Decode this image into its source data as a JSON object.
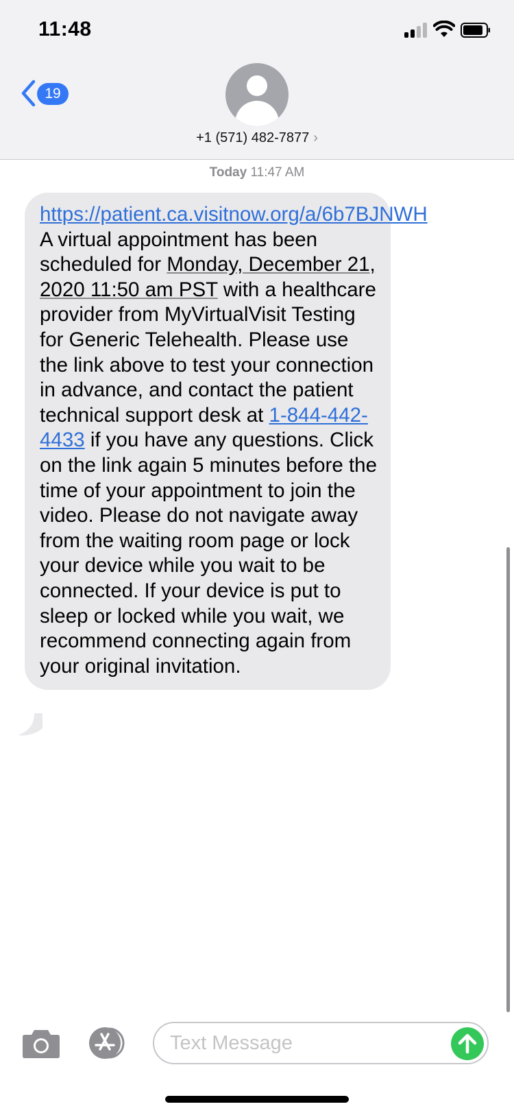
{
  "status_bar": {
    "time": "11:48"
  },
  "header": {
    "back_count": "19",
    "contact_number": "+1 (571) 482-7877",
    "contact_chevron": "›"
  },
  "conversation": {
    "timestamp_day": "Today",
    "timestamp_time": "11:47 AM",
    "message": {
      "link_url": "https://patient.ca.visitnow.org/a/6b7BJNWH",
      "text_1": " A virtual appointment has been scheduled for ",
      "date_text": "Monday, December 21, 2020 11:50 am PST",
      "text_2": " with a healthcare provider from MyVirtualVisit Testing for Generic Telehealth. Please use the link above to test your connection in advance, and contact the patient technical support desk at ",
      "phone_link": "1-844-442-4433",
      "text_3": " if you have any questions. Click on the link again 5 minutes before the time of your appointment to join the video. Please do not navigate away from the waiting room page or lock your device while you wait to be connected. If your device is put to sleep or locked while you wait, we recommend connecting again from your original invitation."
    }
  },
  "input_bar": {
    "placeholder": "Text Message",
    "camera_icon": "camera-icon",
    "apps_icon": "app-store-icon",
    "send_icon": "arrow-up-icon"
  },
  "colors": {
    "accent_blue": "#3478f6",
    "link_blue": "#2f6fd8",
    "bubble_gray": "#e9e9eb",
    "header_bg": "#f2f2f4",
    "send_green": "#34c759"
  }
}
